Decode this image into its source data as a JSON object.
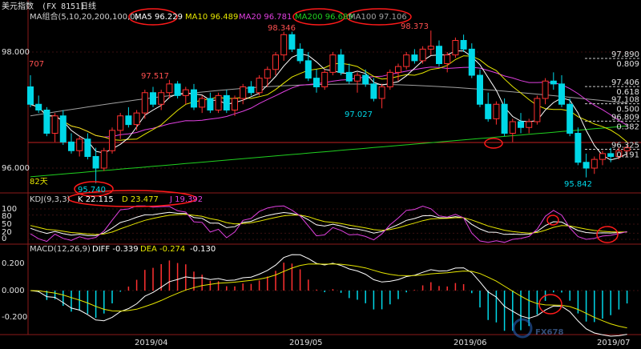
{
  "header": {
    "title": "美元指数",
    "code": "(FX 8151)",
    "period": "日线"
  },
  "ma_legend": [
    {
      "label": "MA组合(5,10,20,200,100,0)",
      "color": "#d0d0d0"
    },
    {
      "label": "MA5 96.229",
      "color": "#ffffff"
    },
    {
      "label": "MA10 96.489",
      "color": "#e6e600"
    },
    {
      "label": "MA20 96.781",
      "color": "#e040e0"
    },
    {
      "label": "MA200 96.689",
      "color": "#20d020"
    },
    {
      "label": "MA100 97.106",
      "color": "#a0a0a0"
    }
  ],
  "kdj_legend": [
    {
      "label": "KDJ(9,3,3)",
      "color": "#d0d0d0"
    },
    {
      "label": "K 22.115",
      "color": "#ffffff"
    },
    {
      "label": "D 23.477",
      "color": "#e6e600"
    },
    {
      "label": "J 19.392",
      "color": "#e040e0"
    }
  ],
  "macd_legend": [
    {
      "label": "MACD(12,26,9)",
      "color": "#d0d0d0"
    },
    {
      "label": "DIFF -0.339",
      "color": "#ffffff"
    },
    {
      "label": "DEA -0.274",
      "color": "#e6e600"
    },
    {
      "label": "-0.130",
      "color": "#ffffff"
    }
  ],
  "price_axis": {
    "ticks": [
      "98.000",
      "96.000"
    ]
  },
  "kdj_axis": {
    "ticks": [
      "100",
      "80",
      "50",
      "20",
      "0"
    ]
  },
  "macd_axis": {
    "ticks": [
      "0.200",
      "0.000",
      "-0.200"
    ]
  },
  "dates": [
    "2019/04",
    "2019/05",
    "2019/06",
    "2019/07"
  ],
  "annotations": {
    "hi_left": "707",
    "hi_apr": "97.517",
    "hi_may": "98.346",
    "hi_may2": "98.373",
    "lo_may": "97.027",
    "lo_mar": "95.740",
    "lo_jun": "95.842",
    "days": "82天"
  },
  "fib_levels": [
    "97.890",
    "0.809",
    "97.406",
    "0.618",
    "97.108",
    "0.500",
    "96.809",
    "0.382",
    "96.325",
    "0.191"
  ],
  "watermark": "FX678",
  "chart_data": {
    "type": "candlestick",
    "title": "美元指数 (FX 8151) 日线",
    "ylim": [
      95.6,
      98.6
    ],
    "colors": {
      "up": "#ff3030",
      "down": "#00d8e8"
    },
    "candles": [
      [
        97.4,
        97.6,
        97.05,
        97.1
      ],
      [
        97.1,
        97.25,
        96.95,
        97.0
      ],
      [
        97.0,
        97.05,
        96.55,
        96.6
      ],
      [
        96.6,
        96.95,
        96.45,
        96.9
      ],
      [
        96.9,
        97.0,
        96.4,
        96.45
      ],
      [
        96.45,
        96.6,
        96.25,
        96.3
      ],
      [
        96.3,
        96.55,
        96.2,
        96.5
      ],
      [
        96.5,
        96.6,
        96.15,
        96.2
      ],
      [
        96.2,
        96.35,
        95.74,
        96.0
      ],
      [
        96.0,
        96.35,
        95.95,
        96.3
      ],
      [
        96.3,
        96.7,
        96.25,
        96.65
      ],
      [
        96.65,
        96.95,
        96.5,
        96.9
      ],
      [
        96.9,
        97.05,
        96.7,
        96.75
      ],
      [
        96.75,
        97.0,
        96.65,
        96.95
      ],
      [
        96.95,
        97.35,
        96.85,
        97.3
      ],
      [
        97.3,
        97.4,
        97.05,
        97.1
      ],
      [
        97.1,
        97.35,
        97.0,
        97.3
      ],
      [
        97.3,
        97.52,
        97.2,
        97.45
      ],
      [
        97.45,
        97.5,
        97.2,
        97.25
      ],
      [
        97.25,
        97.4,
        97.1,
        97.35
      ],
      [
        97.35,
        97.45,
        97.0,
        97.05
      ],
      [
        97.05,
        97.25,
        96.95,
        97.2
      ],
      [
        97.2,
        97.3,
        96.95,
        97.0
      ],
      [
        97.0,
        97.3,
        96.95,
        97.25
      ],
      [
        97.25,
        97.35,
        96.95,
        97.0
      ],
      [
        97.0,
        97.25,
        96.9,
        97.2
      ],
      [
        97.2,
        97.45,
        97.1,
        97.4
      ],
      [
        97.4,
        97.5,
        97.25,
        97.3
      ],
      [
        97.3,
        97.6,
        97.25,
        97.55
      ],
      [
        97.55,
        97.75,
        97.4,
        97.7
      ],
      [
        97.7,
        98.0,
        97.6,
        97.95
      ],
      [
        97.95,
        98.35,
        97.85,
        98.3
      ],
      [
        98.3,
        98.35,
        98.0,
        98.05
      ],
      [
        98.05,
        98.15,
        97.8,
        97.85
      ],
      [
        97.85,
        98.0,
        97.5,
        97.55
      ],
      [
        97.55,
        97.7,
        97.3,
        97.4
      ],
      [
        97.4,
        97.7,
        97.35,
        97.65
      ],
      [
        97.65,
        98.0,
        97.6,
        97.95
      ],
      [
        97.95,
        98.05,
        97.6,
        97.65
      ],
      [
        97.65,
        97.8,
        97.45,
        97.5
      ],
      [
        97.5,
        97.65,
        97.3,
        97.6
      ],
      [
        97.6,
        97.7,
        97.4,
        97.45
      ],
      [
        97.45,
        97.55,
        97.15,
        97.2
      ],
      [
        97.2,
        97.45,
        97.03,
        97.4
      ],
      [
        97.4,
        97.7,
        97.35,
        97.65
      ],
      [
        97.65,
        97.8,
        97.5,
        97.75
      ],
      [
        97.75,
        98.0,
        97.7,
        97.95
      ],
      [
        97.95,
        98.05,
        97.8,
        97.85
      ],
      [
        97.85,
        98.1,
        97.8,
        98.05
      ],
      [
        98.05,
        98.37,
        97.95,
        98.1
      ],
      [
        98.1,
        98.2,
        97.75,
        97.8
      ],
      [
        97.8,
        98.0,
        97.65,
        97.95
      ],
      [
        97.95,
        98.25,
        97.9,
        98.2
      ],
      [
        98.2,
        98.3,
        98.0,
        98.05
      ],
      [
        98.05,
        98.15,
        97.55,
        97.6
      ],
      [
        97.6,
        97.7,
        97.05,
        97.1
      ],
      [
        97.1,
        97.3,
        96.8,
        96.85
      ],
      [
        96.85,
        97.15,
        96.75,
        97.1
      ],
      [
        97.1,
        97.2,
        96.55,
        96.6
      ],
      [
        96.6,
        96.85,
        96.45,
        96.8
      ],
      [
        96.8,
        96.95,
        96.6,
        96.7
      ],
      [
        96.7,
        96.85,
        96.6,
        96.8
      ],
      [
        96.8,
        97.25,
        96.75,
        97.2
      ],
      [
        97.2,
        97.55,
        97.1,
        97.5
      ],
      [
        97.5,
        97.65,
        97.35,
        97.45
      ],
      [
        97.45,
        97.6,
        97.05,
        97.1
      ],
      [
        97.1,
        97.2,
        96.55,
        96.6
      ],
      [
        96.6,
        96.7,
        96.05,
        96.1
      ],
      [
        96.1,
        96.25,
        95.84,
        96.0
      ],
      [
        96.0,
        96.2,
        95.9,
        96.15
      ],
      [
        96.15,
        96.3,
        96.05,
        96.25
      ],
      [
        96.25,
        96.35,
        96.1,
        96.2
      ],
      [
        96.2,
        96.35,
        96.15,
        96.3
      ],
      [
        96.3,
        96.4,
        96.2,
        96.35
      ]
    ]
  }
}
